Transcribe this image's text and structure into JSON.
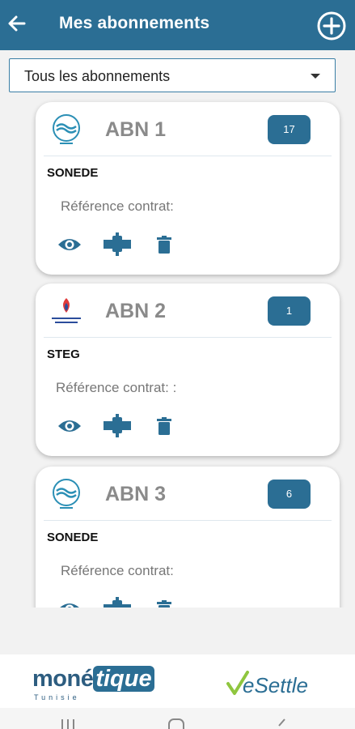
{
  "header": {
    "title": "Mes abonnements"
  },
  "filter": {
    "selected": "Tous les abonnements"
  },
  "subscriptions": [
    {
      "name": "ABN 1",
      "badge": "17",
      "provider": "SONEDE",
      "reference_label": "Référence contrat:",
      "logo": "sonede-logo"
    },
    {
      "name": "ABN 2",
      "badge": "1",
      "provider": "STEG",
      "reference_label": "Référence contrat: :",
      "logo": "steg-logo"
    },
    {
      "name": "ABN 3",
      "badge": "6",
      "provider": "SONEDE",
      "reference_label": "Référence contrat:",
      "logo": "sonede-logo"
    }
  ],
  "footer": {
    "brand_left_part1": "moné",
    "brand_left_part2": "tique",
    "brand_left_sub": "Tunisie",
    "brand_right": "eSettle"
  },
  "colors": {
    "primary": "#2b6e94",
    "badge": "#2b6e94",
    "esettle_green": "#8fc63f",
    "esettle_blue": "#2b6e94"
  }
}
